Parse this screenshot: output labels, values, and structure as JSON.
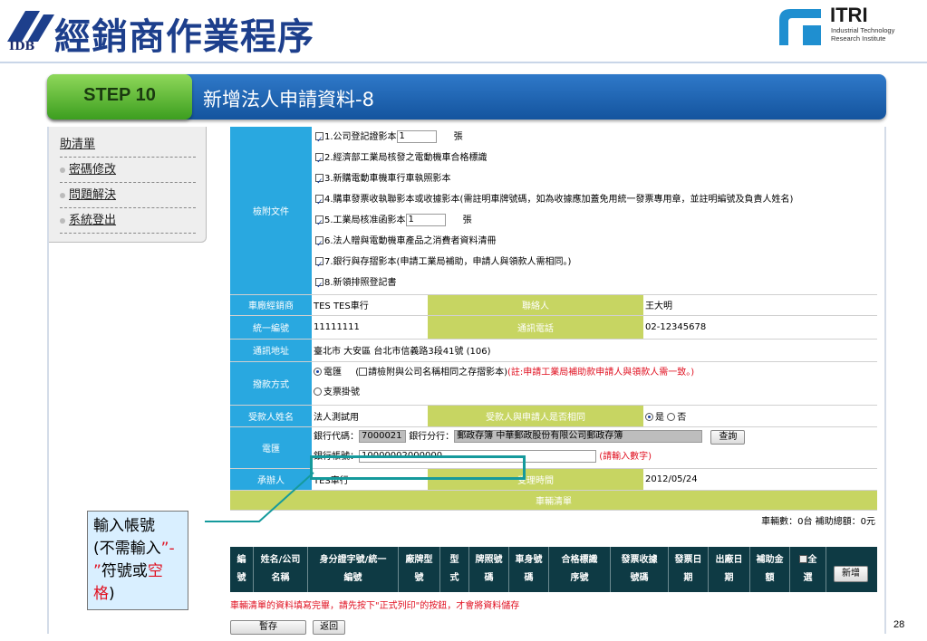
{
  "header": {
    "title": "經銷商作業程序",
    "idb_logo": "IDB",
    "itri_logo": "ITRI",
    "itri_sub1": "Industrial Technology",
    "itri_sub2": "Research Institute"
  },
  "step": {
    "badge": "STEP 10",
    "title": "新增法人申請資料-8"
  },
  "menu": {
    "items": [
      {
        "label": "助清單"
      },
      {
        "label": "密碼修改"
      },
      {
        "label": "問題解決"
      },
      {
        "label": "系統登出"
      }
    ]
  },
  "form": {
    "attach_label": "檢附文件",
    "docs": {
      "d1": "1.公司登記證影本",
      "d1_count": "1",
      "d1_unit": "張",
      "d2": "2.經濟部工業局核發之電動機車合格標識",
      "d3": "3.新購電動車機車行車執照影本",
      "d4": "4.購車發票收執聯影本或收據影本(需註明車牌號碼，如為收據應加蓋免用統一發票專用章，並註明編號及負責人姓名)",
      "d5": "5.工業局核准函影本",
      "d5_count": "1",
      "d5_unit": "張",
      "d6": "6.法人贈與電動機車產品之消費者資料清冊",
      "d7": "7.銀行與存摺影本(申請工業局補助，申請人與領款人需相同。)",
      "d8": "8.新領排照登記書"
    },
    "dealer_label": "車廠經銷商",
    "dealer_value": "TES TES車行",
    "contact_label": "聯絡人",
    "contact_value": "王大明",
    "taxid_label": "統一編號",
    "taxid_value": "11111111",
    "phone_label": "通訊電話",
    "phone_value": "02-12345678",
    "address_label": "通訊地址",
    "address_value": "臺北市 大安區 台北市信義路3段41號 (106)",
    "payment_label": "撥款方式",
    "pay_wire": "電匯",
    "pay_wire_note": "請檢附與公司名稱相同之存摺影本)",
    "pay_wire_note_prefix": "(",
    "pay_wire_red": "(註:申請工業局補助款申請人與領款人需一致。)",
    "pay_check": "支票掛號",
    "payee_label": "受款人姓名",
    "payee_value": "法人測試用",
    "same_label": "受款人與申請人是否相同",
    "same_yes": "是",
    "same_no": "否",
    "wire_label": "電匯",
    "bank_code_label": "銀行代碼：",
    "bank_code_value": "7000021",
    "branch_label": "銀行分行：",
    "branch_value": "郵政存簿  中華郵政股份有限公司郵政存簿",
    "query_button": "查詢",
    "account_label": "銀行帳號：",
    "account_value": "10000002000000",
    "account_hint": "(請輸入數字)",
    "handler_label": "承辦人",
    "handler_value": "TES車行",
    "accept_label": "受理時間",
    "accept_value": "2012/05/24",
    "vehicle_list_label": "車輛清單",
    "summary": "車輛數：0台  補助總額：0元"
  },
  "list": {
    "headers": [
      [
        "編",
        "號"
      ],
      [
        "姓名/公司",
        "名稱"
      ],
      [
        "身分證字號/統一",
        "編號"
      ],
      [
        "廠牌型",
        "號"
      ],
      [
        "型",
        "式"
      ],
      [
        "牌照號",
        "碼"
      ],
      [
        "車身號",
        "碼"
      ],
      [
        "合格標識",
        "序號"
      ],
      [
        "發票收據",
        "號碼"
      ],
      [
        "發票日",
        "期"
      ],
      [
        "出廠日",
        "期"
      ],
      [
        "補助金",
        "額"
      ],
      [
        "全",
        "選"
      ]
    ],
    "add_button": "新增",
    "notice": "車輛清單的資料填寫完畢，請先按下\"正式列印\"的按鈕，才會將資料儲存",
    "save_button": "暫存",
    "back_button": "返回"
  },
  "callout": {
    "line1": "輸入帳號",
    "line2_a": "(不需輸入",
    "line2_b": "”-",
    "line3_a": "”",
    "line3_b": "符號或",
    "line3_c": "空",
    "line4_a": "格",
    "line4_b": ")"
  },
  "page_number": "28",
  "colors": {
    "step_blue": "#1a5fae",
    "step_green": "#5cb83a",
    "label_blue": "#29a8e0",
    "label_olive": "#c7d562",
    "highlight_teal": "#159a9c",
    "red": "#e01020"
  }
}
